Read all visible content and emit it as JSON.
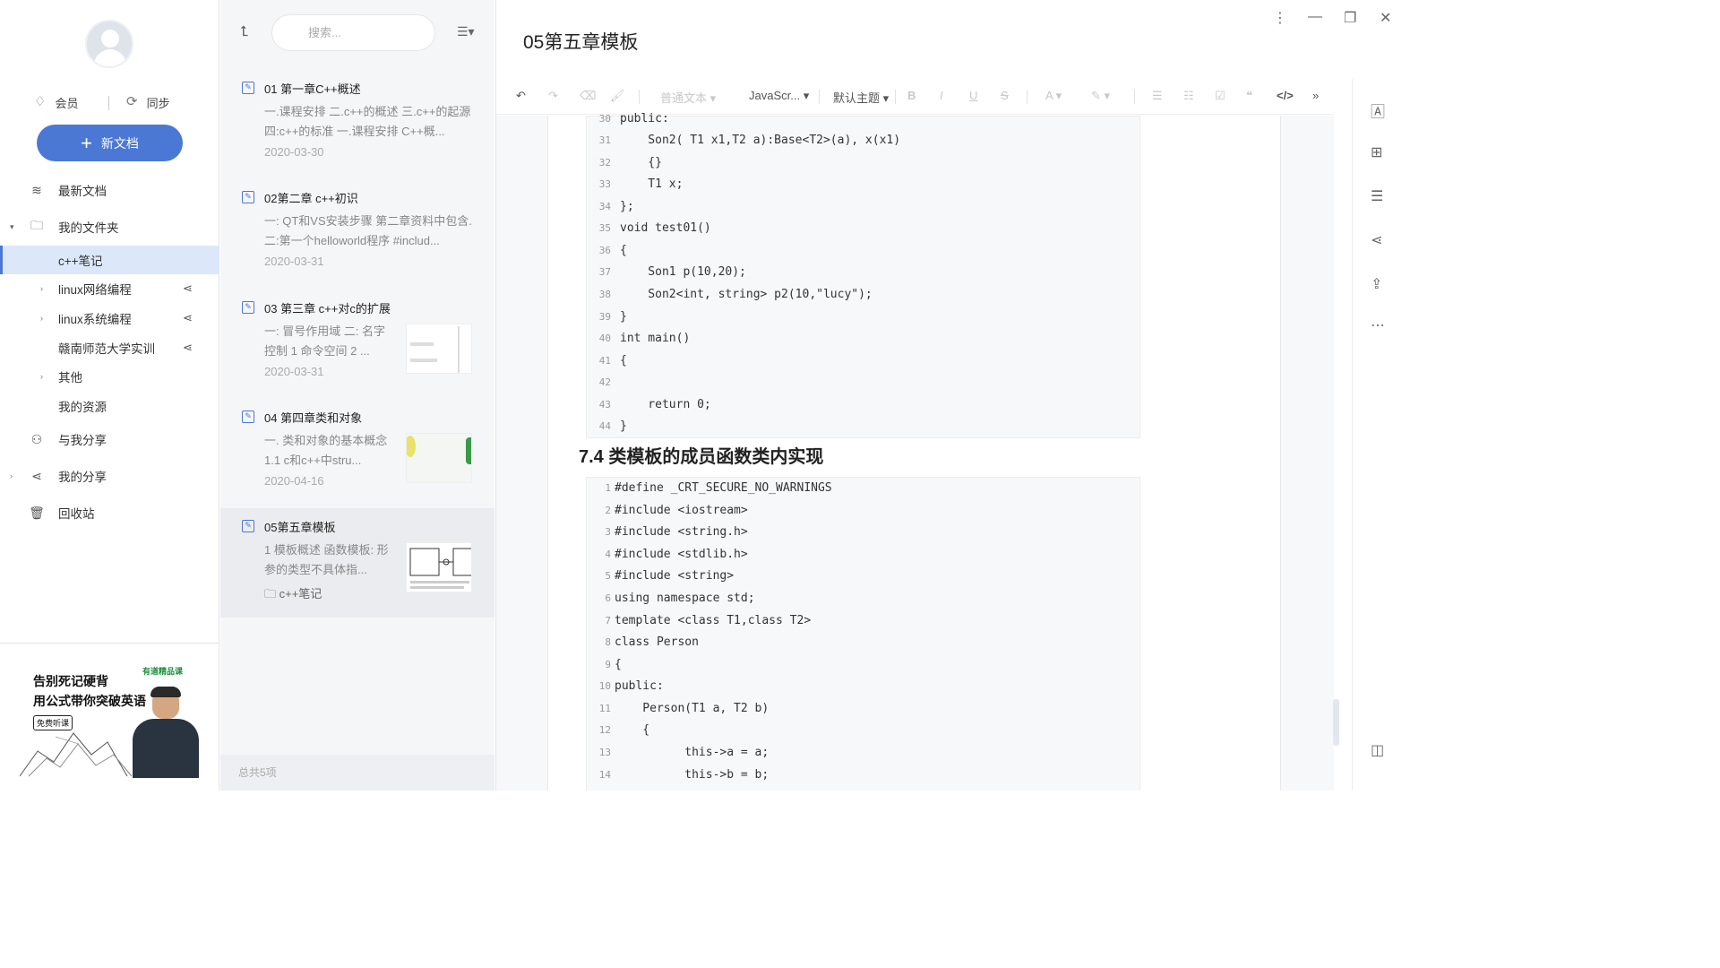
{
  "sidebar": {
    "vip_label": "会员",
    "sync_label": "同步",
    "new_doc_label": "新文档",
    "nav": {
      "recent": "最新文档",
      "my_folders": "我的文件夹",
      "cpp_notes": "c++笔记",
      "linux_net": "linux网络编程",
      "linux_sys": "linux系统编程",
      "gnnu": "赣南师范大学实训",
      "other": "其他",
      "my_resources": "我的资源",
      "shared_with_me": "与我分享",
      "my_shares": "我的分享",
      "trash": "回收站"
    },
    "ad": {
      "line1": "告别死记硬背",
      "line2": "用公式带你突破英语",
      "button": "免费听课",
      "brand": "有道精品课"
    }
  },
  "list": {
    "search_placeholder": "搜索...",
    "notes": [
      {
        "title": "01 第一章C++概述",
        "summary": "一.课程安排 二.c++的概述 三.c++的起源 四:c++的标准 一.课程安排 C++概...",
        "date": "2020-03-30"
      },
      {
        "title": "02第二章 c++初识",
        "summary": "一: QT和VS安装步骤 第二章资料中包含. 二:第一个helloworld程序 #includ...",
        "date": "2020-03-31"
      },
      {
        "title": "03 第三章 c++对c的扩展",
        "summary": "一: 冒号作用域 二: 名字控制 1 命令空间 2 ...",
        "date": "2020-03-31"
      },
      {
        "title": "04 第四章类和对象",
        "summary": "一. 类和对象的基本概念 1.1 c和c++中stru...",
        "date": "2020-04-16"
      },
      {
        "title": "05第五章模板",
        "summary": "1 模板概述 函数模板: 形参的类型不具体指...",
        "folder": "c++笔记"
      }
    ],
    "footer": "总共5项"
  },
  "editor": {
    "title": "05第五章模板",
    "toolbar": {
      "paragraph": "普通文本",
      "language": "JavaScr...",
      "theme": "默认主题"
    },
    "heading": "7.4 类模板的成员函数类内实现",
    "block1": [
      {
        "n": "30",
        "t": "public:"
      },
      {
        "n": "31",
        "t": "    Son2( T1 x1,T2 a):Base<T2>(a), x(x1)"
      },
      {
        "n": "32",
        "t": "    {}"
      },
      {
        "n": "33",
        "t": "    T1 x;"
      },
      {
        "n": "34",
        "t": "};"
      },
      {
        "n": "35",
        "t": "void test01()"
      },
      {
        "n": "36",
        "t": "{"
      },
      {
        "n": "37",
        "t": "    Son1 p(10,20);"
      },
      {
        "n": "38",
        "t": "    Son2<int, string> p2(10,\"lucy\");"
      },
      {
        "n": "39",
        "t": "}"
      },
      {
        "n": "40",
        "t": "int main()"
      },
      {
        "n": "41",
        "t": "{"
      },
      {
        "n": "42",
        "t": ""
      },
      {
        "n": "43",
        "t": "    return 0;"
      },
      {
        "n": "44",
        "t": "}"
      }
    ],
    "block2": [
      {
        "n": "1",
        "t": "#define _CRT_SECURE_NO_WARNINGS"
      },
      {
        "n": "2",
        "t": "#include <iostream>"
      },
      {
        "n": "3",
        "t": "#include <string.h>"
      },
      {
        "n": "4",
        "t": "#include <stdlib.h>"
      },
      {
        "n": "5",
        "t": "#include <string>"
      },
      {
        "n": "6",
        "t": "using namespace std;"
      },
      {
        "n": "7",
        "t": "template <class T1,class T2>"
      },
      {
        "n": "8",
        "t": "class Person"
      },
      {
        "n": "9",
        "t": "{"
      },
      {
        "n": "10",
        "t": "public:"
      },
      {
        "n": "11",
        "t": "    Person(T1 a, T2 b)"
      },
      {
        "n": "12",
        "t": "    {"
      },
      {
        "n": "13",
        "t": "          this->a = a;"
      },
      {
        "n": "14",
        "t": "          this->b = b;"
      }
    ]
  },
  "colors": {
    "accent": "#4b78d4",
    "active_bg": "#dce8fa"
  }
}
